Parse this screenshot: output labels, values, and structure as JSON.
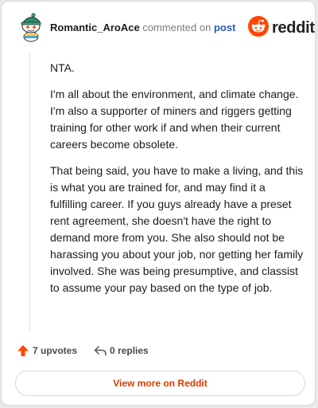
{
  "header": {
    "username": "Romantic_AroAce",
    "action_text": "commented on",
    "post_link": "post",
    "brand": "reddit"
  },
  "comment": {
    "paragraphs": [
      "NTA.",
      "I'm all about the environment, and climate change. I'm also a supporter of miners and riggers getting training for other work if and when their current careers become obsolete.",
      "That being said, you have to make a living, and this is what you are trained for, and may find it a fulfilling career. If you guys already have a preset rent agreement, she doesn't have the right to demand more from you. She also should not be harassing you about your job, nor getting her family involved. She was being presumptive, and classist to assume your pay based on the type of job."
    ]
  },
  "actions": {
    "upvotes": "7 upvotes",
    "replies": "0 replies"
  },
  "footer": {
    "view_button": "View more on Reddit"
  },
  "colors": {
    "accent": "#d93a00",
    "upvote": "#ff4500",
    "link": "#2a5db0"
  },
  "icons": {
    "avatar": "snoo-avatar-icon",
    "logo": "reddit-logo-icon",
    "upvote": "upvote-arrow-icon",
    "reply": "reply-arrow-icon"
  }
}
